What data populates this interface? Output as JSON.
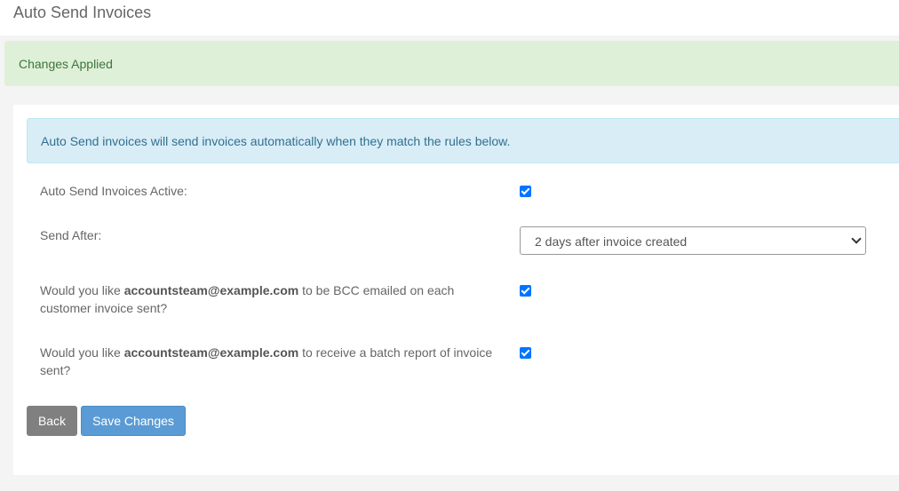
{
  "page": {
    "title": "Auto Send Invoices"
  },
  "alerts": {
    "success": "Changes Applied",
    "info": "Auto Send invoices will send invoices automatically when they match the rules below."
  },
  "form": {
    "active_label": "Auto Send Invoices Active:",
    "active_checked": true,
    "send_after_label": "Send After:",
    "send_after_value": "2 days after invoice created",
    "bcc": {
      "prefix": "Would you like ",
      "email": "accountsteam@example.com",
      "suffix": " to be BCC emailed on each customer invoice sent?",
      "checked": true
    },
    "batch": {
      "prefix": "Would you like ",
      "email": "accountsteam@example.com",
      "suffix": " to receive a batch report of invoice sent?",
      "checked": true
    }
  },
  "buttons": {
    "back": "Back",
    "save": "Save Changes"
  },
  "colors": {
    "success_bg": "#dff0d8",
    "success_text": "#3c763d",
    "info_bg": "#d9edf7",
    "info_text": "#31708f",
    "checkbox": "#0075ff",
    "save_button": "#5b9bd5",
    "back_button": "#808080"
  }
}
